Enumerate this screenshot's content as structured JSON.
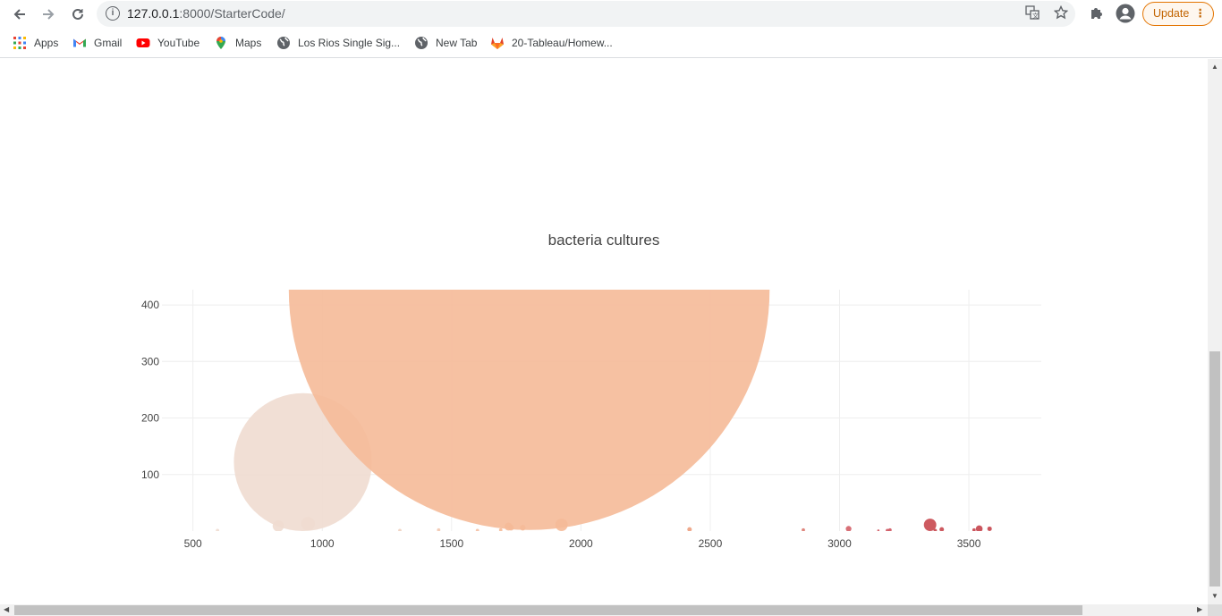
{
  "browser": {
    "url_host": "127.0.0.1",
    "url_path": ":8000/StarterCode/",
    "update_label": "Update"
  },
  "bookmarks": [
    {
      "label": "Apps",
      "icon": "apps-grid-icon"
    },
    {
      "label": "Gmail",
      "icon": "gmail-icon"
    },
    {
      "label": "YouTube",
      "icon": "youtube-icon"
    },
    {
      "label": "Maps",
      "icon": "maps-pin-icon"
    },
    {
      "label": "Los Rios Single Sig...",
      "icon": "globe-icon"
    },
    {
      "label": "New Tab",
      "icon": "globe-icon"
    },
    {
      "label": "20-Tableau/Homew...",
      "icon": "gitlab-icon"
    }
  ],
  "chart_data": {
    "type": "scatter",
    "title": "bacteria cultures",
    "xlabel": "",
    "ylabel": "",
    "xlim": [
      380,
      3780
    ],
    "ylim": [
      0,
      427
    ],
    "x_ticks": [
      500,
      1000,
      1500,
      2000,
      2500,
      3000,
      3500
    ],
    "y_ticks": [
      100,
      200,
      300,
      400
    ],
    "grid": true,
    "legend": "none",
    "points": [
      {
        "x": 595,
        "y": 1,
        "size": 3,
        "color": "#efdcd0"
      },
      {
        "x": 830,
        "y": 9,
        "size": 10,
        "color": "#efdcd0"
      },
      {
        "x": 925,
        "y": 122,
        "size": 122,
        "color": "#efdcd0"
      },
      {
        "x": 945,
        "y": 13,
        "size": 12,
        "color": "#efdcd0"
      },
      {
        "x": 1300,
        "y": 1,
        "size": 3,
        "color": "#f0d2c0"
      },
      {
        "x": 1450,
        "y": 2,
        "size": 3,
        "color": "#f2c8b0"
      },
      {
        "x": 1600,
        "y": 1,
        "size": 3,
        "color": "#f4c0a4"
      },
      {
        "x": 1690,
        "y": 2,
        "size": 3,
        "color": "#f5ba98"
      },
      {
        "x": 1720,
        "y": 8,
        "size": 7,
        "color": "#f5ba98"
      },
      {
        "x": 1730,
        "y": 6,
        "size": 5,
        "color": "#f5ba98"
      },
      {
        "x": 1775,
        "y": 6,
        "size": 5,
        "color": "#f5ba98"
      },
      {
        "x": 1800,
        "y": 427,
        "size": 425,
        "color": "#f5ba98"
      },
      {
        "x": 1925,
        "y": 11,
        "size": 11,
        "color": "#f5ba98"
      },
      {
        "x": 2420,
        "y": 3,
        "size": 4,
        "color": "#eda080"
      },
      {
        "x": 2860,
        "y": 2,
        "size": 3,
        "color": "#dc7a70"
      },
      {
        "x": 3035,
        "y": 4,
        "size": 5,
        "color": "#d46068"
      },
      {
        "x": 3150,
        "y": 1,
        "size": 2,
        "color": "#d05860"
      },
      {
        "x": 3185,
        "y": 1,
        "size": 3,
        "color": "#cf5560"
      },
      {
        "x": 3195,
        "y": 2,
        "size": 3,
        "color": "#cf5560"
      },
      {
        "x": 3350,
        "y": 11,
        "size": 11,
        "color": "#c8484f"
      },
      {
        "x": 3370,
        "y": 1,
        "size": 3,
        "color": "#c8484f"
      },
      {
        "x": 3395,
        "y": 3,
        "size": 4,
        "color": "#c8484f"
      },
      {
        "x": 3520,
        "y": 2,
        "size": 3,
        "color": "#c5444c"
      },
      {
        "x": 3540,
        "y": 4,
        "size": 6,
        "color": "#c5444c"
      },
      {
        "x": 3580,
        "y": 4,
        "size": 4,
        "color": "#c5444c"
      }
    ]
  }
}
